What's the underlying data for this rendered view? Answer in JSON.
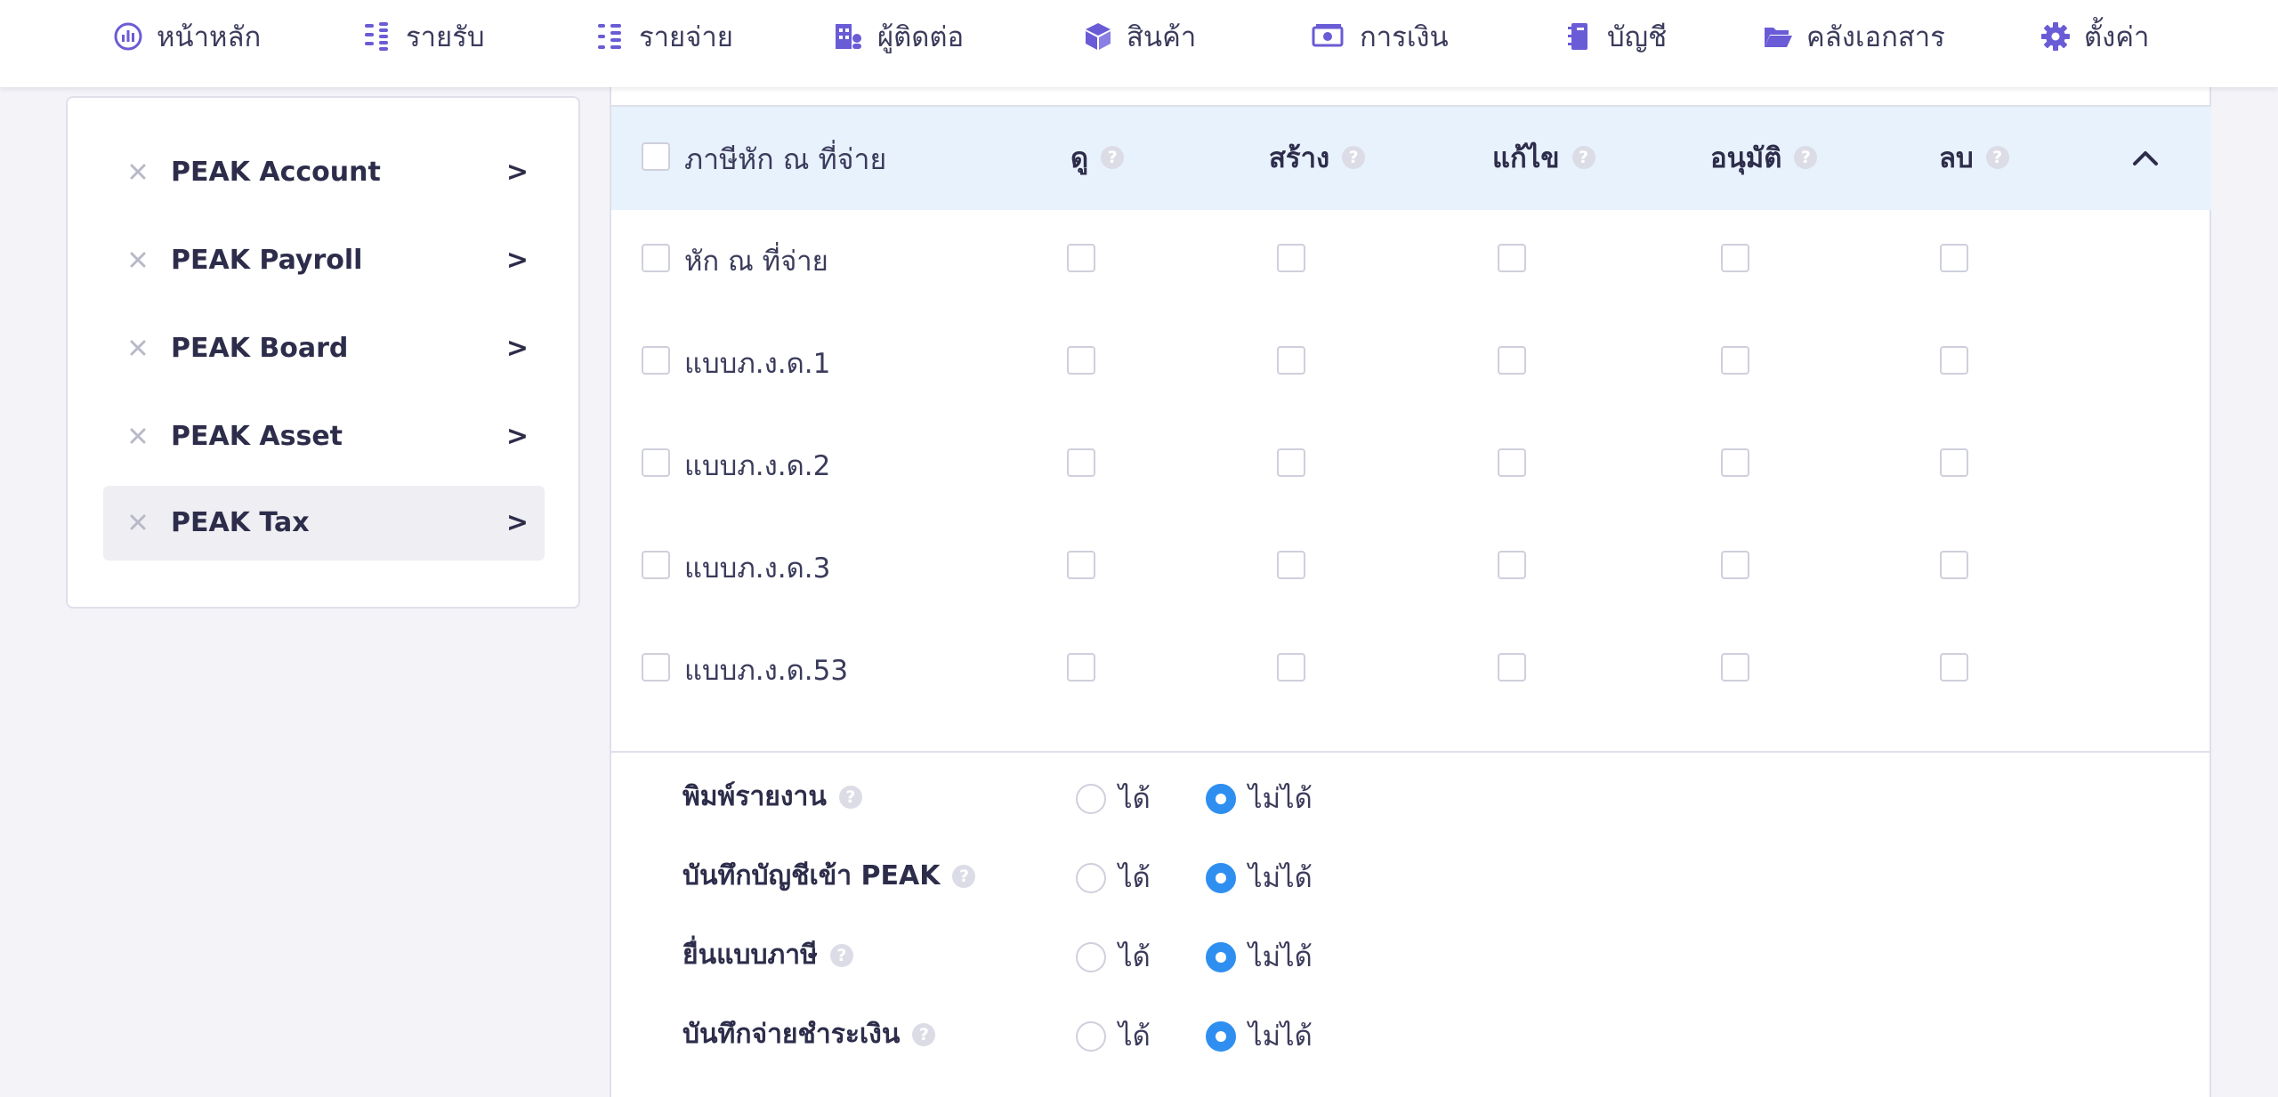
{
  "topnav": {
    "items": [
      {
        "label": "หน้าหลัก",
        "icon": "dashboard-gauge-icon"
      },
      {
        "label": "รายรับ",
        "icon": "income-list-icon"
      },
      {
        "label": "รายจ่าย",
        "icon": "expense-list-icon"
      },
      {
        "label": "ผู้ติดต่อ",
        "icon": "contacts-building-icon"
      },
      {
        "label": "สินค้า",
        "icon": "product-box-icon"
      },
      {
        "label": "การเงิน",
        "icon": "money-bill-icon"
      },
      {
        "label": "บัญชี",
        "icon": "ledger-book-icon"
      },
      {
        "label": "คลังเอกสาร",
        "icon": "folder-open-icon"
      },
      {
        "label": "ตั้งค่า",
        "icon": "gear-icon"
      }
    ]
  },
  "sidebar": {
    "items": [
      {
        "label": "PEAK Account",
        "chevron": ">"
      },
      {
        "label": "PEAK Payroll",
        "chevron": ">"
      },
      {
        "label": "PEAK Board",
        "chevron": ">"
      },
      {
        "label": "PEAK Asset",
        "chevron": ">"
      },
      {
        "label": "PEAK Tax",
        "chevron": ">",
        "active": true
      }
    ]
  },
  "permissions": {
    "group_title": "ภาษีหัก ณ ที่จ่าย",
    "columns": [
      "ดู",
      "สร้าง",
      "แก้ไข",
      "อนุมัติ",
      "ลบ"
    ],
    "help_glyph": "?",
    "rows": [
      {
        "label": "หัก ณ ที่จ่าย"
      },
      {
        "label": "แบบภ.ง.ด.1"
      },
      {
        "label": "แบบภ.ง.ด.2"
      },
      {
        "label": "แบบภ.ง.ด.3"
      },
      {
        "label": "แบบภ.ง.ด.53"
      }
    ]
  },
  "options": {
    "yes_label": "ได้",
    "no_label": "ไม่ได้",
    "items": [
      {
        "label": "พิมพ์รายงาน",
        "selected": "no"
      },
      {
        "label": "บันทึกบัญชีเข้า PEAK",
        "selected": "no"
      },
      {
        "label": "ยื่นแบบภาษี",
        "selected": "no"
      },
      {
        "label": "บันทึกจ่ายชำระเงิน",
        "selected": "no"
      }
    ]
  },
  "colors": {
    "accent": "#6a5cd6",
    "radio_on": "#2f8ff0",
    "header_bg": "#e8f2fc",
    "page_bg": "#f3f3f8"
  }
}
